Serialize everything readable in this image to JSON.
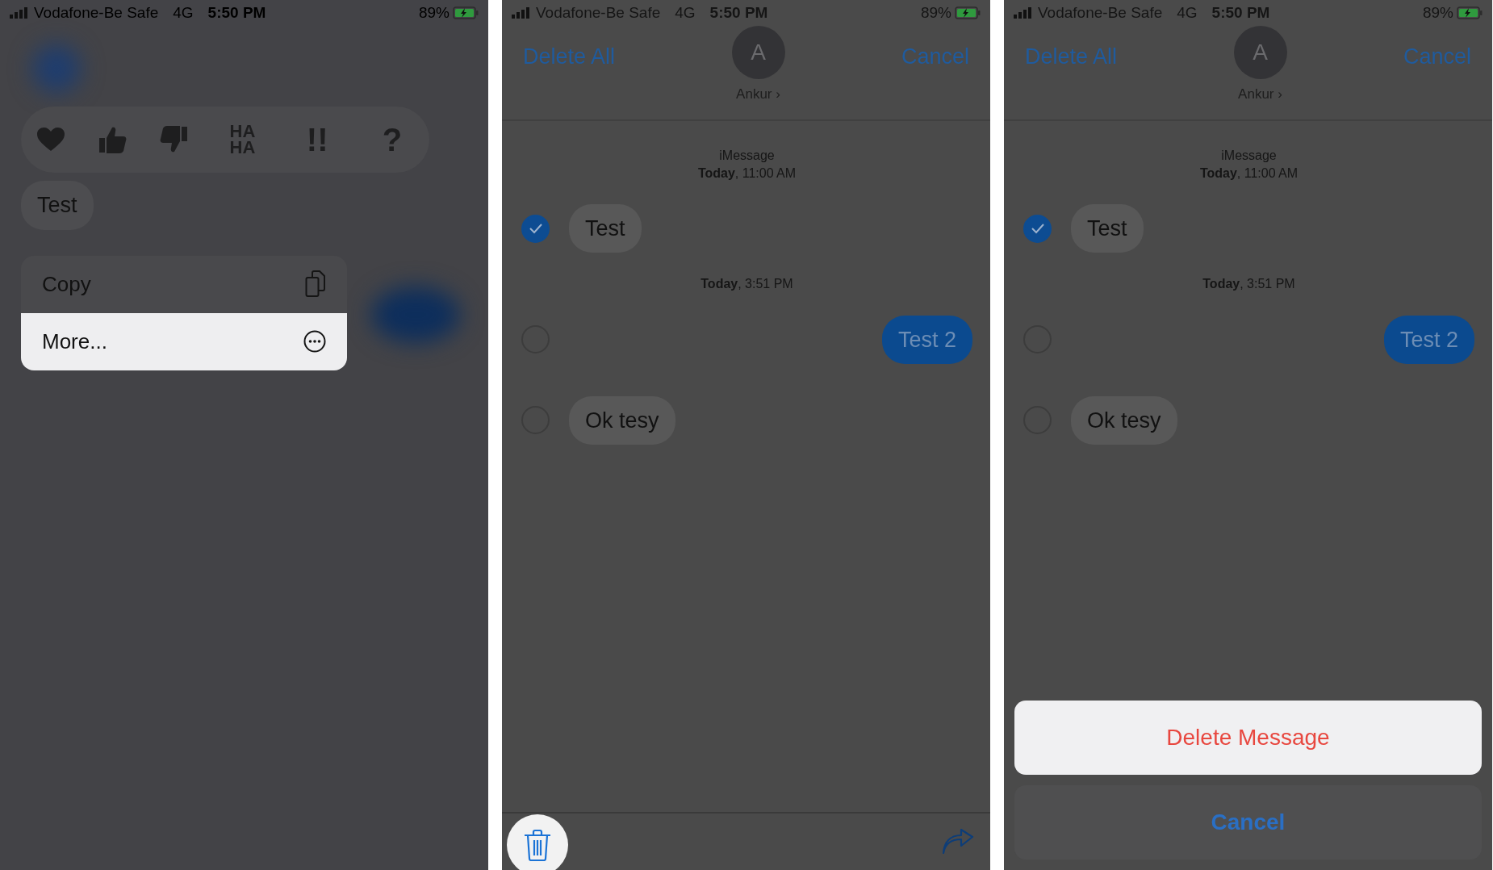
{
  "panels": [
    {
      "kind": "context-menu",
      "status_bar": {
        "carrier": "Vodafone-Be Safe",
        "network": "4G",
        "time": "5:50 PM",
        "battery": "89%",
        "charging": true
      },
      "reactions": [
        {
          "kind": "heart"
        },
        {
          "kind": "thumbs-up"
        },
        {
          "kind": "thumbs-down"
        },
        {
          "kind": "text",
          "text": "HA HA"
        },
        {
          "kind": "text",
          "text": "!!"
        },
        {
          "kind": "text",
          "text": "?"
        }
      ],
      "message": {
        "text": "Test"
      },
      "menu": [
        {
          "label": "Copy",
          "selected": false
        },
        {
          "label": "More...",
          "selected": true
        }
      ]
    },
    {
      "kind": "select",
      "status_bar": {
        "carrier": "Vodafone-Be Safe",
        "network": "4G",
        "time": "5:50 PM",
        "battery": "89%",
        "charging": true
      },
      "header": {
        "left": "Delete All",
        "avatar": "A",
        "contact": "Ankur ›",
        "right": "Cancel"
      },
      "messages": [
        {
          "kind": "timestamp",
          "lines": [
            "iMessage",
            "**Today**, 11:00 AM"
          ]
        },
        {
          "kind": "bubble",
          "text": "Test",
          "outgoing": false,
          "selected": true
        },
        {
          "kind": "timestamp",
          "lines": [
            "**Today**, 3:51 PM"
          ]
        },
        {
          "kind": "bubble",
          "text": "Test 2",
          "outgoing": true,
          "selected": false
        },
        {
          "kind": "bubble",
          "text": "Ok tesy",
          "outgoing": false,
          "selected": false
        }
      ]
    },
    {
      "kind": "confirm",
      "status_bar": {
        "carrier": "Vodafone-Be Safe",
        "network": "4G",
        "time": "5:50 PM",
        "battery": "89%",
        "charging": true
      },
      "header": {
        "left": "Delete All",
        "avatar": "A",
        "contact": "Ankur ›",
        "right": "Cancel"
      },
      "messages": [
        {
          "kind": "timestamp",
          "lines": [
            "iMessage",
            "**Today**, 11:00 AM"
          ]
        },
        {
          "kind": "bubble",
          "text": "Test",
          "outgoing": false,
          "selected": true
        },
        {
          "kind": "timestamp",
          "lines": [
            "**Today**, 3:51 PM"
          ]
        },
        {
          "kind": "bubble",
          "text": "Test 2",
          "outgoing": true,
          "selected": false
        },
        {
          "kind": "bubble",
          "text": "Ok tesy",
          "outgoing": false,
          "selected": false
        }
      ],
      "action_sheet": {
        "destructive": "Delete Message",
        "cancel": "Cancel"
      }
    }
  ]
}
